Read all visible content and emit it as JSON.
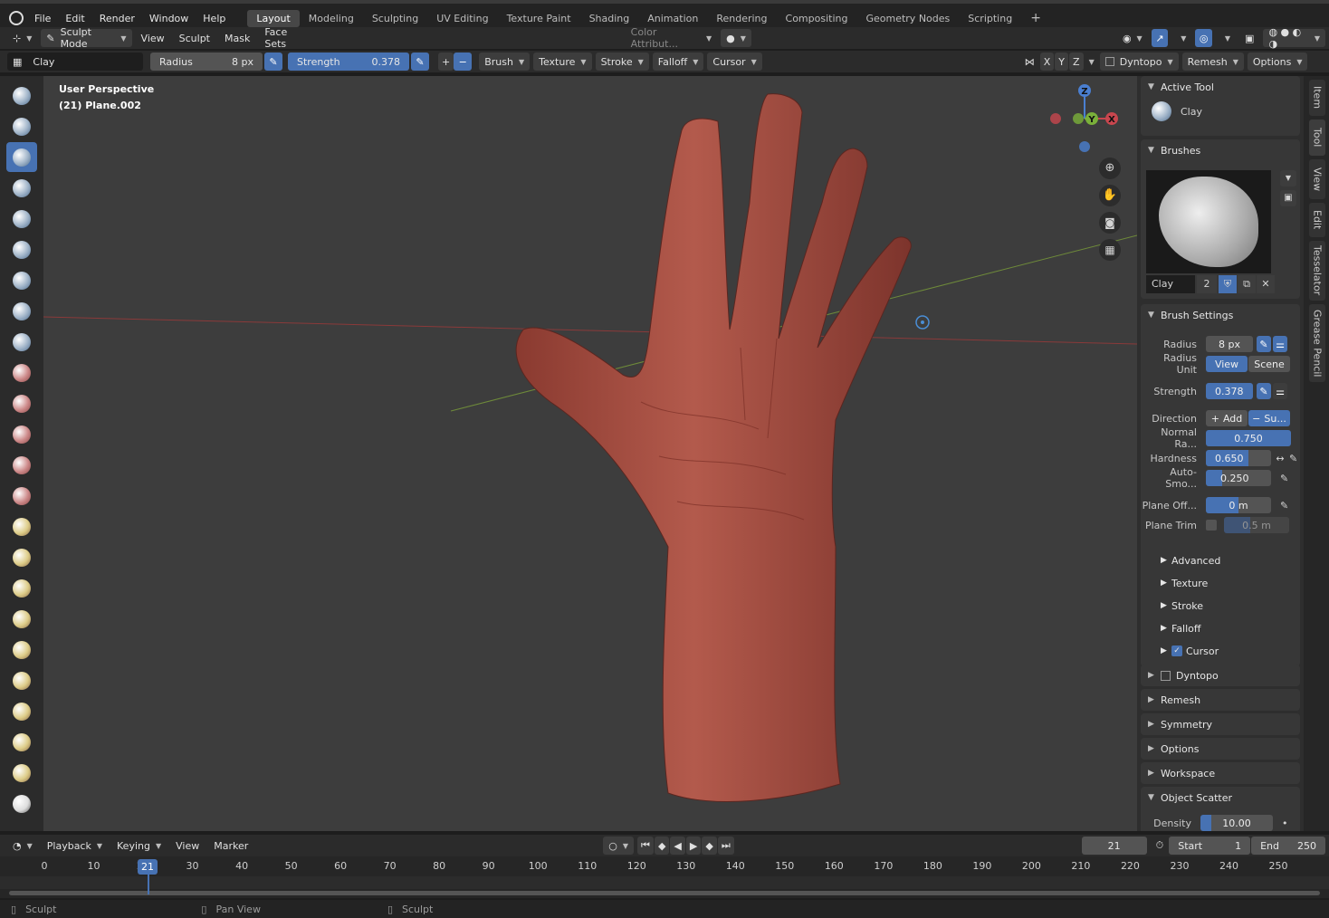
{
  "menu": {
    "items": [
      "File",
      "Edit",
      "Render",
      "Window",
      "Help"
    ]
  },
  "workspaces": [
    "Layout",
    "Modeling",
    "Sculpting",
    "UV Editing",
    "Texture Paint",
    "Shading",
    "Animation",
    "Rendering",
    "Compositing",
    "Geometry Nodes",
    "Scripting"
  ],
  "active_workspace": "Layout",
  "header": {
    "mode": "Sculpt Mode",
    "menus": [
      "View",
      "Sculpt",
      "Mask",
      "Face Sets"
    ],
    "color_attribute": "Color Attribut..."
  },
  "tool_settings": {
    "brush_name": "Clay",
    "radius_label": "Radius",
    "radius_value": "8 px",
    "strength_label": "Strength",
    "strength_value": "0.378",
    "menus": [
      "Brush",
      "Texture",
      "Stroke",
      "Falloff",
      "Cursor"
    ],
    "axes": [
      "X",
      "Y",
      "Z"
    ],
    "dyntopo": "Dyntopo",
    "remesh": "Remesh",
    "options": "Options"
  },
  "viewport": {
    "perspective": "User Perspective",
    "object": "(21) Plane.002",
    "gizmo": {
      "z": "Z",
      "y": "Y",
      "x": "X"
    }
  },
  "npanel": {
    "tabs": [
      "Item",
      "Tool",
      "View",
      "Edit",
      "Tesselator",
      "Grease Pencil"
    ],
    "active_tool": {
      "title": "Active Tool",
      "name": "Clay"
    },
    "brushes": {
      "title": "Brushes",
      "name": "Clay",
      "users": "2"
    },
    "brush_settings": {
      "title": "Brush Settings",
      "radius": {
        "label": "Radius",
        "value": "8 px"
      },
      "radius_unit": {
        "label": "Radius Unit",
        "opt1": "View",
        "opt2": "Scene"
      },
      "strength": {
        "label": "Strength",
        "value": "0.378"
      },
      "direction": {
        "label": "Direction",
        "add": "Add",
        "sub": "Su..."
      },
      "normal_radius": {
        "label": "Normal Ra...",
        "value": "0.750"
      },
      "hardness": {
        "label": "Hardness",
        "value": "0.650"
      },
      "auto_smooth": {
        "label": "Auto-Smo...",
        "value": "0.250"
      },
      "plane_offset": {
        "label": "Plane Off...",
        "value": "0 m"
      },
      "plane_trim": {
        "label": "Plane Trim",
        "value": "0.5 m"
      },
      "subpanels": [
        "Advanced",
        "Texture",
        "Stroke",
        "Falloff",
        "Cursor"
      ]
    },
    "panels": [
      "Dyntopo",
      "Remesh",
      "Symmetry",
      "Options",
      "Workspace"
    ],
    "object_scatter": {
      "title": "Object Scatter",
      "density_label": "Density",
      "density_value": "10.00"
    }
  },
  "timeline": {
    "menus": [
      "Playback",
      "Keying",
      "View",
      "Marker"
    ],
    "current_frame": "21",
    "start_label": "Start",
    "start": "1",
    "end_label": "End",
    "end": "250",
    "ticks": [
      "0",
      "10",
      "20",
      "30",
      "40",
      "50",
      "60",
      "70",
      "80",
      "90",
      "100",
      "110",
      "120",
      "130",
      "140",
      "150",
      "160",
      "170",
      "180",
      "190",
      "200",
      "210",
      "220",
      "230",
      "240",
      "250"
    ]
  },
  "status": {
    "left": "Sculpt",
    "middle": "Pan View",
    "right": "Sculpt"
  },
  "colors": {
    "accent": "#4772b3",
    "skin": "#b35a4c",
    "bg": "#3d3d3d"
  }
}
